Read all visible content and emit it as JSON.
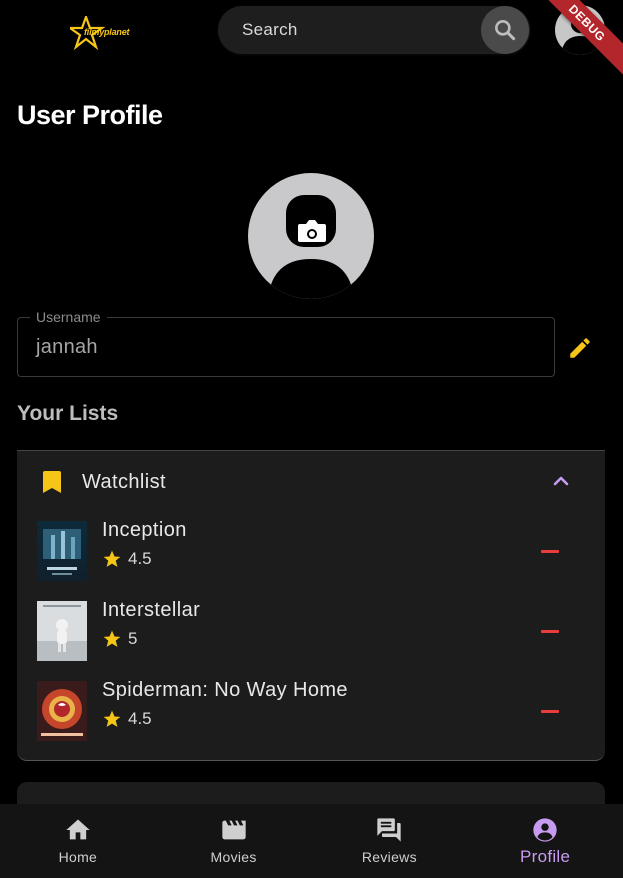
{
  "app": {
    "logo_text": "filmyplanet",
    "debug_banner": "DEBUG"
  },
  "search": {
    "placeholder": "Search"
  },
  "page": {
    "title": "User Profile"
  },
  "profile": {
    "username_label": "Username",
    "username_value": "jannah"
  },
  "lists": {
    "section_title": "Your Lists",
    "watchlist": {
      "title": "Watchlist",
      "items": [
        {
          "title": "Inception",
          "rating": "4.5"
        },
        {
          "title": "Interstellar",
          "rating": "5"
        },
        {
          "title": "Spiderman: No Way Home",
          "rating": "4.5"
        }
      ]
    }
  },
  "colors": {
    "accent": "#f5c518",
    "remove": "#ec3b3b",
    "active_nav": "#c79cf0"
  },
  "nav": {
    "items": [
      {
        "label": "Home",
        "icon": "home-icon"
      },
      {
        "label": "Movies",
        "icon": "movie-icon"
      },
      {
        "label": "Reviews",
        "icon": "reviews-icon"
      },
      {
        "label": "Profile",
        "icon": "profile-icon"
      }
    ],
    "active": "Profile"
  }
}
